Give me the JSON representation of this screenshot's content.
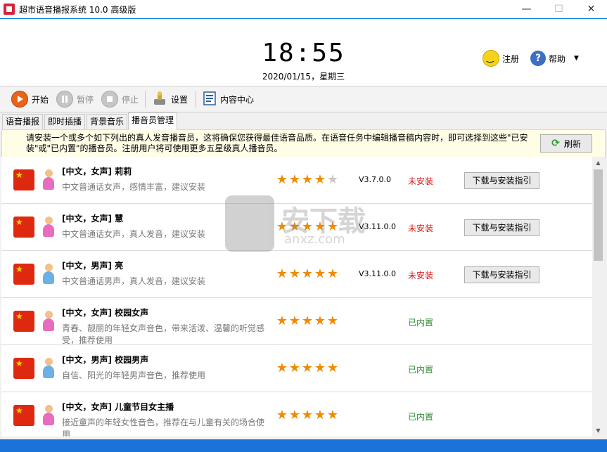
{
  "window": {
    "title": "超市语音播报系统 10.0 高级版",
    "min": "—",
    "max": "☐",
    "close": "✕"
  },
  "header": {
    "time": "18:55",
    "date": "2020/01/15，星期三",
    "register_label": "注册",
    "help_label": "帮助",
    "help_arrow": "▼"
  },
  "toolbar": {
    "start_label": "开始",
    "pause_label": "暂停",
    "stop_label": "停止",
    "settings_label": "设置",
    "content_label": "内容中心"
  },
  "tabs": [
    "语音播报",
    "即时插播",
    "背景音乐",
    "播音员管理"
  ],
  "notice": {
    "text": "请安装一个或多个如下列出的真人发音播音员，这将确保您获得最佳语音品质。在语音任务中编辑播音稿内容时，即可选择到这些\"已安装\"或\"已内置\"的播音员。注册用户将可使用更多五星级真人播音员。",
    "refresh_label": "刷新"
  },
  "voices": [
    {
      "name": "[中文，女声] 莉莉",
      "desc": "中文普通话女声，感情丰富，建议安装",
      "rating": 4,
      "version": "V3.7.0.0",
      "status": "未安装",
      "status_kind": "red",
      "gender": "female",
      "button": "下载与安装指引"
    },
    {
      "name": "[中文，女声] 慧",
      "desc": "中文普通话女声，真人发音，建议安装",
      "rating": 5,
      "version": "V3.11.0.0",
      "status": "未安装",
      "status_kind": "red",
      "gender": "female",
      "button": "下载与安装指引"
    },
    {
      "name": "[中文，男声] 亮",
      "desc": "中文普通话男声，真人发音，建议安装",
      "rating": 5,
      "version": "V3.11.0.0",
      "status": "未安装",
      "status_kind": "red",
      "gender": "male",
      "button": "下载与安装指引"
    },
    {
      "name": "[中文，女声] 校园女声",
      "desc": "青春、靓丽的年轻女声音色，带来活泼、温馨的听觉感受，推荐使用",
      "rating": 5,
      "version": "",
      "status": "已内置",
      "status_kind": "green",
      "gender": "female",
      "button": ""
    },
    {
      "name": "[中文，男声] 校园男声",
      "desc": "自信、阳光的年轻男声音色，推荐使用",
      "rating": 5,
      "version": "",
      "status": "已内置",
      "status_kind": "green",
      "gender": "male",
      "button": ""
    },
    {
      "name": "[中文，女声] 儿童节目女主播",
      "desc": "接近童声的年轻女性音色，推荐在与儿童有关的场合使用",
      "rating": 5,
      "version": "",
      "status": "已内置",
      "status_kind": "green",
      "gender": "female",
      "button": ""
    }
  ],
  "watermark": {
    "text": "安下载",
    "sub": "anxz.com"
  },
  "colors": {
    "accent": "#0078d7",
    "statusbar": "#1a73d8",
    "star": "#f08a00",
    "not_installed": "#e01b1b",
    "builtin": "#2e8b2e"
  }
}
